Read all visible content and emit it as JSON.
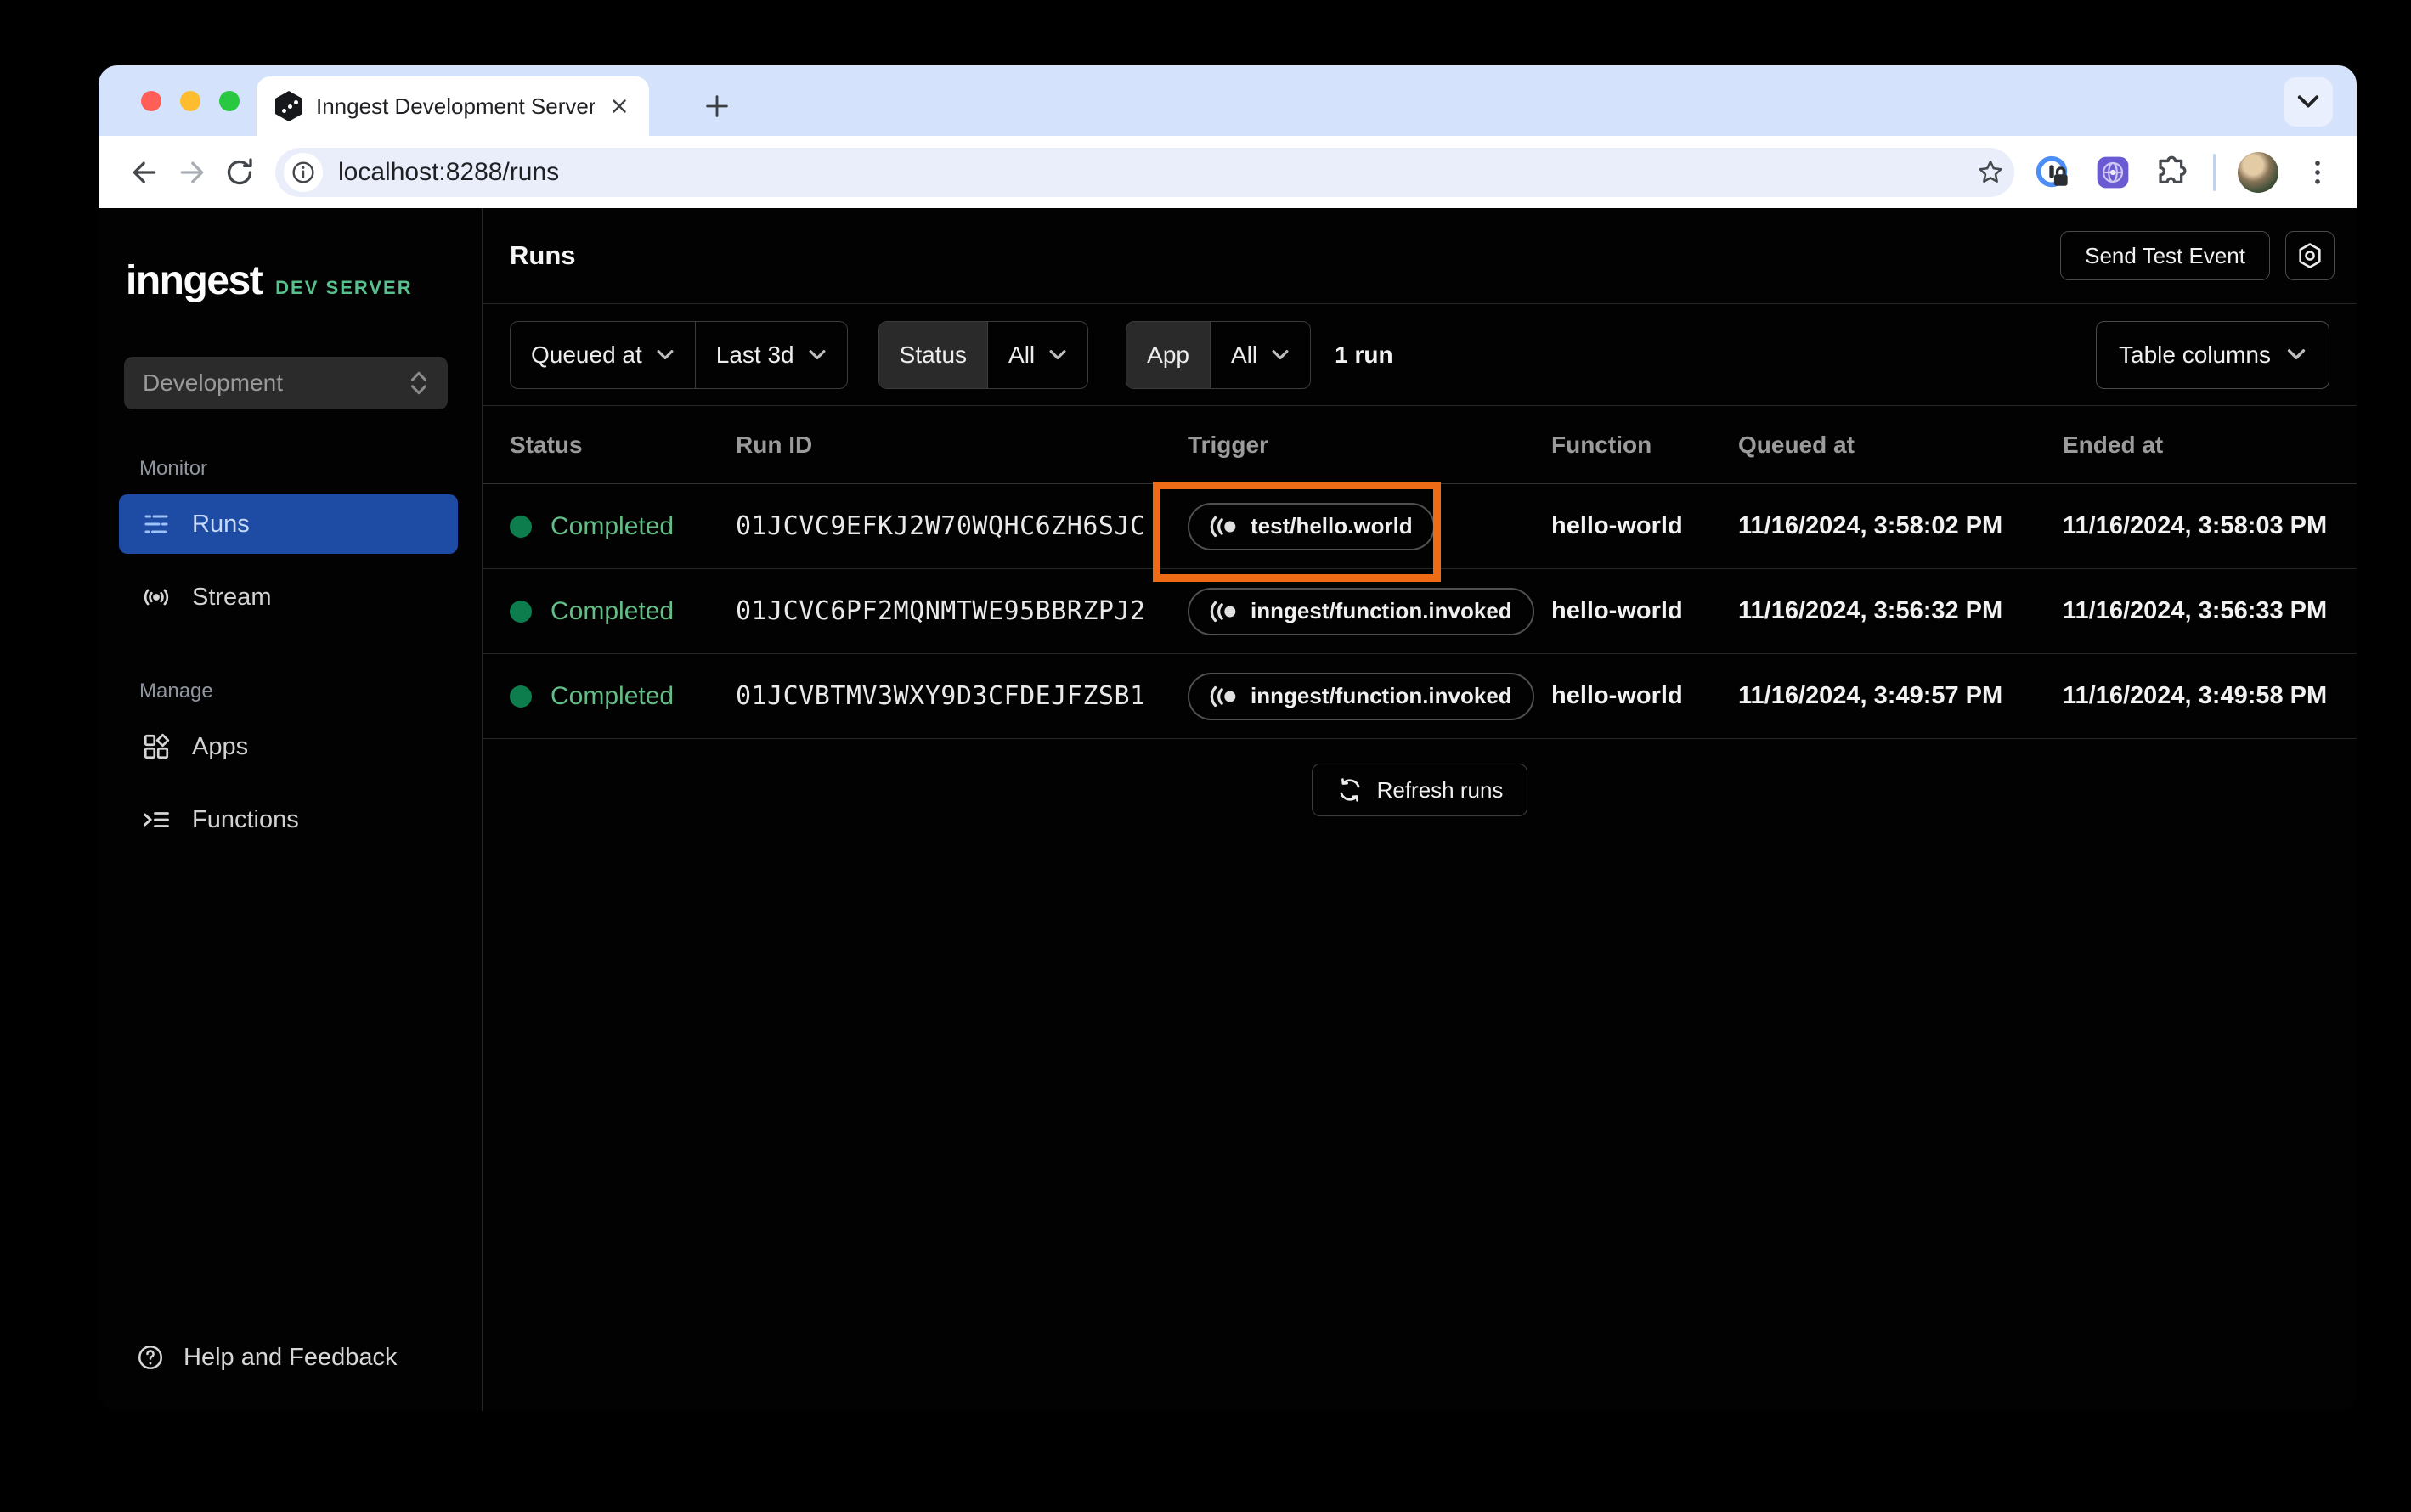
{
  "browser": {
    "tab_title": "Inngest Development Server",
    "url": "localhost:8288/runs"
  },
  "sidebar": {
    "logo_text": "inngest",
    "logo_badge": "DEV SERVER",
    "env_selector_value": "Development",
    "monitor_label": "Monitor",
    "manage_label": "Manage",
    "nav": {
      "runs": "Runs",
      "stream": "Stream",
      "apps": "Apps",
      "functions": "Functions"
    },
    "help_label": "Help and Feedback"
  },
  "header": {
    "title": "Runs",
    "send_test_event_label": "Send Test Event"
  },
  "filters": {
    "field_label": "Queued at",
    "range_label": "Last 3d",
    "status_label": "Status",
    "status_value": "All",
    "app_label": "App",
    "app_value": "All",
    "result_count": "1 run",
    "table_columns_label": "Table columns"
  },
  "table": {
    "columns": [
      "Status",
      "Run ID",
      "Trigger",
      "Function",
      "Queued at",
      "Ended at"
    ],
    "rows": [
      {
        "status": "Completed",
        "run_id": "01JCVC9EFKJ2W70WQHC6ZH6SJC",
        "trigger": "test/hello.world",
        "function": "hello-world",
        "queued_at": "11/16/2024, 3:58:02 PM",
        "ended_at": "11/16/2024, 3:58:03 PM",
        "highlighted": true
      },
      {
        "status": "Completed",
        "run_id": "01JCVC6PF2MQNMTWE95BBRZPJ2",
        "trigger": "inngest/function.invoked",
        "function": "hello-world",
        "queued_at": "11/16/2024, 3:56:32 PM",
        "ended_at": "11/16/2024, 3:56:33 PM",
        "highlighted": false
      },
      {
        "status": "Completed",
        "run_id": "01JCVBTMV3WXY9D3CFDEJFZSB1",
        "trigger": "inngest/function.invoked",
        "function": "hello-world",
        "queued_at": "11/16/2024, 3:49:57 PM",
        "ended_at": "11/16/2024, 3:49:58 PM",
        "highlighted": false
      }
    ],
    "refresh_label": "Refresh runs"
  },
  "colors": {
    "highlight_orange": "#EE6C16",
    "active_nav_blue": "#1E4BA3",
    "status_green_dot": "#0D7D4D",
    "status_green_text": "#64BD86",
    "brand_green": "#57C08D"
  }
}
